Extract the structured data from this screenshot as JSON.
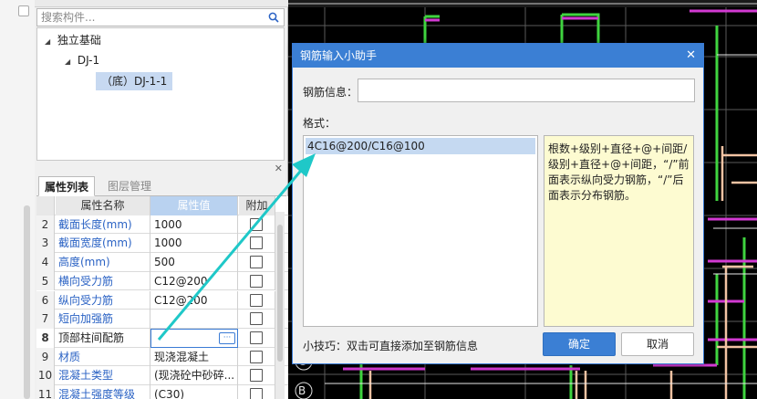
{
  "search": {
    "placeholder": "搜索构件..."
  },
  "tree": {
    "root": "独立基础",
    "child": "DJ-1",
    "leaf": "（底）DJ-1-1"
  },
  "tabs": {
    "props": "属性列表",
    "layers": "图层管理"
  },
  "grid": {
    "headers": {
      "name": "属性名称",
      "value": "属性值",
      "extra": "附加"
    },
    "rows": [
      {
        "no": "2",
        "name": "截面长度(mm)",
        "value": "1000",
        "color": "blue"
      },
      {
        "no": "3",
        "name": "截面宽度(mm)",
        "value": "1000",
        "color": "blue"
      },
      {
        "no": "4",
        "name": "高度(mm)",
        "value": "500",
        "color": "blue"
      },
      {
        "no": "5",
        "name": "横向受力筋",
        "value": "C12@200",
        "color": "blue"
      },
      {
        "no": "6",
        "name": "纵向受力筋",
        "value": "C12@200",
        "color": "blue"
      },
      {
        "no": "7",
        "name": "短向加强筋",
        "value": "",
        "color": "blue"
      },
      {
        "no": "8",
        "name": "顶部柱间配筋",
        "value": "",
        "color": "dark",
        "selected": true
      },
      {
        "no": "9",
        "name": "材质",
        "value": "现浇混凝土",
        "color": "blue"
      },
      {
        "no": "10",
        "name": "混凝土类型",
        "value": "(现浇砼中砂碎...",
        "color": "blue"
      },
      {
        "no": "11",
        "name": "混凝土强度等级",
        "value": "(C30)",
        "color": "blue"
      }
    ]
  },
  "dialog": {
    "title": "钢筋输入小助手",
    "info_label": "钢筋信息：",
    "info_value": "",
    "format_label": "格式：",
    "format_item": "4C16@200/C16@100",
    "hint": "根数+级别+直径+@+间距/级别+直径+@+间距，“/”前面表示纵向受力钢筋，“/”后面表示分布钢筋。",
    "tip": "小技巧：双击可直接添加至钢筋信息",
    "ok": "确定",
    "cancel": "取消"
  },
  "cad_labels": {
    "c": "C",
    "b": "B"
  },
  "colors": {
    "accent": "#3b7fd4",
    "arrow": "#1fc8c8",
    "hint_bg": "#fdfbd1"
  }
}
